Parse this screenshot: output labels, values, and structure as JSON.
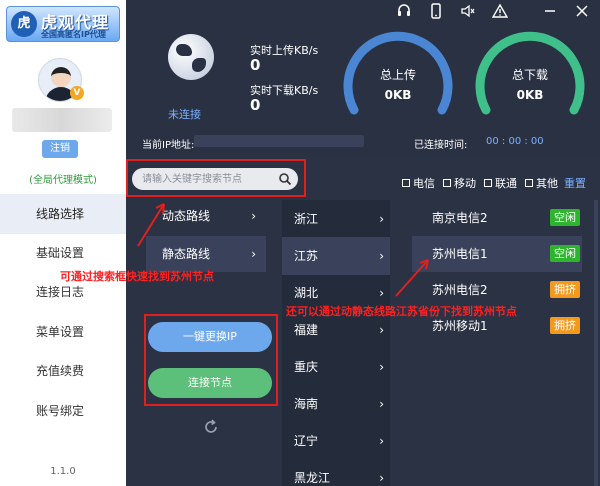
{
  "app": {
    "logo_mark": "虎",
    "logo_title": "虎观代理",
    "logo_sub": "全国高匿名IP代理",
    "version": "1.1.0"
  },
  "user": {
    "vip_badge": "V",
    "logout_label": "注销",
    "mode_text": "(全局代理模式)"
  },
  "sidebar": {
    "items": [
      {
        "label": "线路选择",
        "active": true
      },
      {
        "label": "基础设置"
      },
      {
        "label": "连接日志"
      },
      {
        "label": "菜单设置"
      },
      {
        "label": "充值续费"
      },
      {
        "label": "账号绑定"
      }
    ]
  },
  "top_icons": [
    "headset-icon",
    "phone-icon",
    "speaker-icon",
    "warning-icon",
    "minimize-icon",
    "close-icon"
  ],
  "header": {
    "status": "未连接",
    "upload_label": "实时上传KB/s",
    "upload_value": "0",
    "download_label": "实时下载KB/s",
    "download_value": "0",
    "total_upload_label": "总上传",
    "total_upload_value": "0KB",
    "total_download_label": "总下载",
    "total_download_value": "0KB",
    "ip_label": "当前IP地址:",
    "connected_time_label": "已连接时间:",
    "connected_time_value": "00 : 00 : 00"
  },
  "search": {
    "placeholder": "请输入关键字搜索节点"
  },
  "filters": [
    {
      "label": "电信"
    },
    {
      "label": "移动"
    },
    {
      "label": "联通"
    },
    {
      "label": "其他"
    }
  ],
  "reset_label": "重置",
  "routes": [
    {
      "label": "动态路线",
      "chev": "›"
    },
    {
      "label": "静态路线",
      "chev": "›",
      "active": true
    }
  ],
  "provinces": [
    {
      "label": "浙江",
      "chev": "›"
    },
    {
      "label": "江苏",
      "chev": "›",
      "active": true
    },
    {
      "label": "湖北",
      "chev": "›"
    },
    {
      "label": "福建",
      "chev": "›"
    },
    {
      "label": "重庆",
      "chev": "›"
    },
    {
      "label": "海南",
      "chev": "›"
    },
    {
      "label": "辽宁",
      "chev": "›"
    },
    {
      "label": "黑龙江",
      "chev": "›"
    }
  ],
  "nodes": [
    {
      "label": "南京电信2",
      "tag": "空闲",
      "tag_color": "#2db52d"
    },
    {
      "label": "苏州电信1",
      "tag": "空闲",
      "tag_color": "#2db52d",
      "active": true
    },
    {
      "label": "苏州电信2",
      "tag": "拥挤",
      "tag_color": "#f39a1e"
    },
    {
      "label": "苏州移动1",
      "tag": "拥挤",
      "tag_color": "#f39a1e"
    }
  ],
  "buttons": {
    "change_ip": "一键更换IP",
    "connect": "连接节点"
  },
  "annotations": {
    "search_tip": "可通过搜索框快速找到苏州节点",
    "route_tip": "还可以通过动静态线路江苏省份下找到苏州节点"
  },
  "colors": {
    "accent_blue": "#6ea8ec",
    "upload_gauge": "#4a86d4",
    "download_gauge": "#3fbf8a",
    "annotation_red": "#e02020"
  }
}
